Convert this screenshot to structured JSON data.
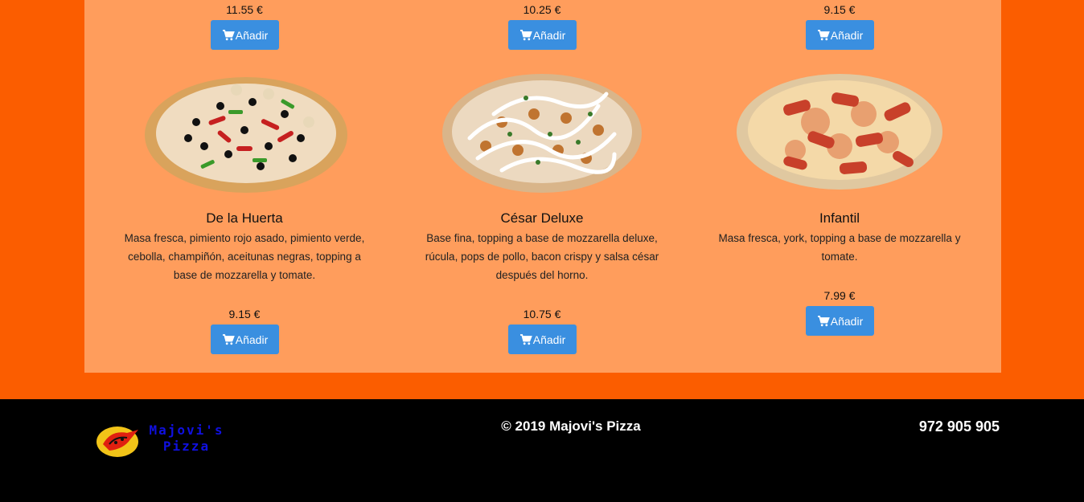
{
  "top_row": {
    "prices": [
      "11.55 €",
      "10.25 €",
      "9.15 €"
    ],
    "button_label": "Añadir"
  },
  "pizzas": [
    {
      "name": "De la Huerta",
      "description": "Masa fresca, pimiento rojo asado, pimiento verde, cebolla, champiñón, aceitunas negras, topping a base de mozzarella y tomate.",
      "price": "9.15 €",
      "button_label": "Añadir"
    },
    {
      "name": "César Deluxe",
      "description": "Base fina, topping a base de mozzarella deluxe, rúcula, pops de pollo, bacon crispy y salsa césar después del horno.",
      "price": "10.75 €",
      "button_label": "Añadir"
    },
    {
      "name": "Infantil",
      "description": "Masa fresca, york, topping a base de mozzarella y tomate.",
      "price": "7.99 €",
      "button_label": "Añadir"
    }
  ],
  "footer": {
    "logo_text_line1": "Majovi's",
    "logo_text_line2": "Pizza",
    "copyright": "© 2019 Majovi's Pizza",
    "phone": "972 905 905"
  },
  "colors": {
    "page_background": "#fb5d00",
    "panel_background": "#ff9d5c",
    "button": "#3a8fe0",
    "footer_background": "#000000"
  },
  "icons": {
    "button_icon": "cart-icon"
  }
}
